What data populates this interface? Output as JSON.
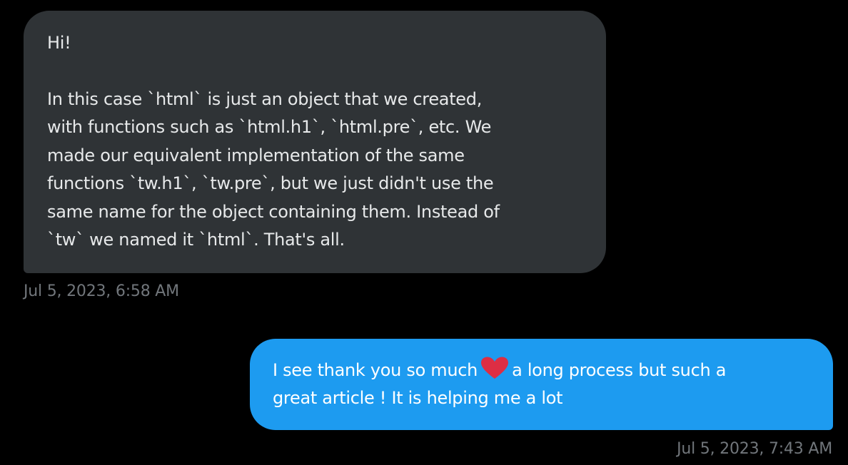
{
  "messages": [
    {
      "direction": "received",
      "greeting": "Hi!",
      "lines": [
        "In this case `html` is just an object that we created,",
        "with functions such as `html.h1`, `html.pre`, etc. We",
        "made our equivalent implementation of the same",
        "functions `tw.h1`, `tw.pre`, but we just didn't use the",
        "same name for the object containing them. Instead of",
        "`tw` we named it `html`. That's all."
      ],
      "timestamp": "Jul 5, 2023, 6:58 AM"
    },
    {
      "direction": "sent",
      "text_before_emoji": "I see thank you so much",
      "emoji": "red-heart",
      "text_after_emoji": "a long process but such a",
      "line2": "great article ! It is helping me a lot",
      "timestamp": "Jul 5, 2023, 7:43 AM"
    }
  ],
  "colors": {
    "background": "#000000",
    "received_bubble": "#2f3336",
    "received_text": "#e7e9ea",
    "sent_bubble": "#1d9bf0",
    "sent_text": "#ffffff",
    "timestamp": "#71767b",
    "heart": "#e0245e"
  }
}
